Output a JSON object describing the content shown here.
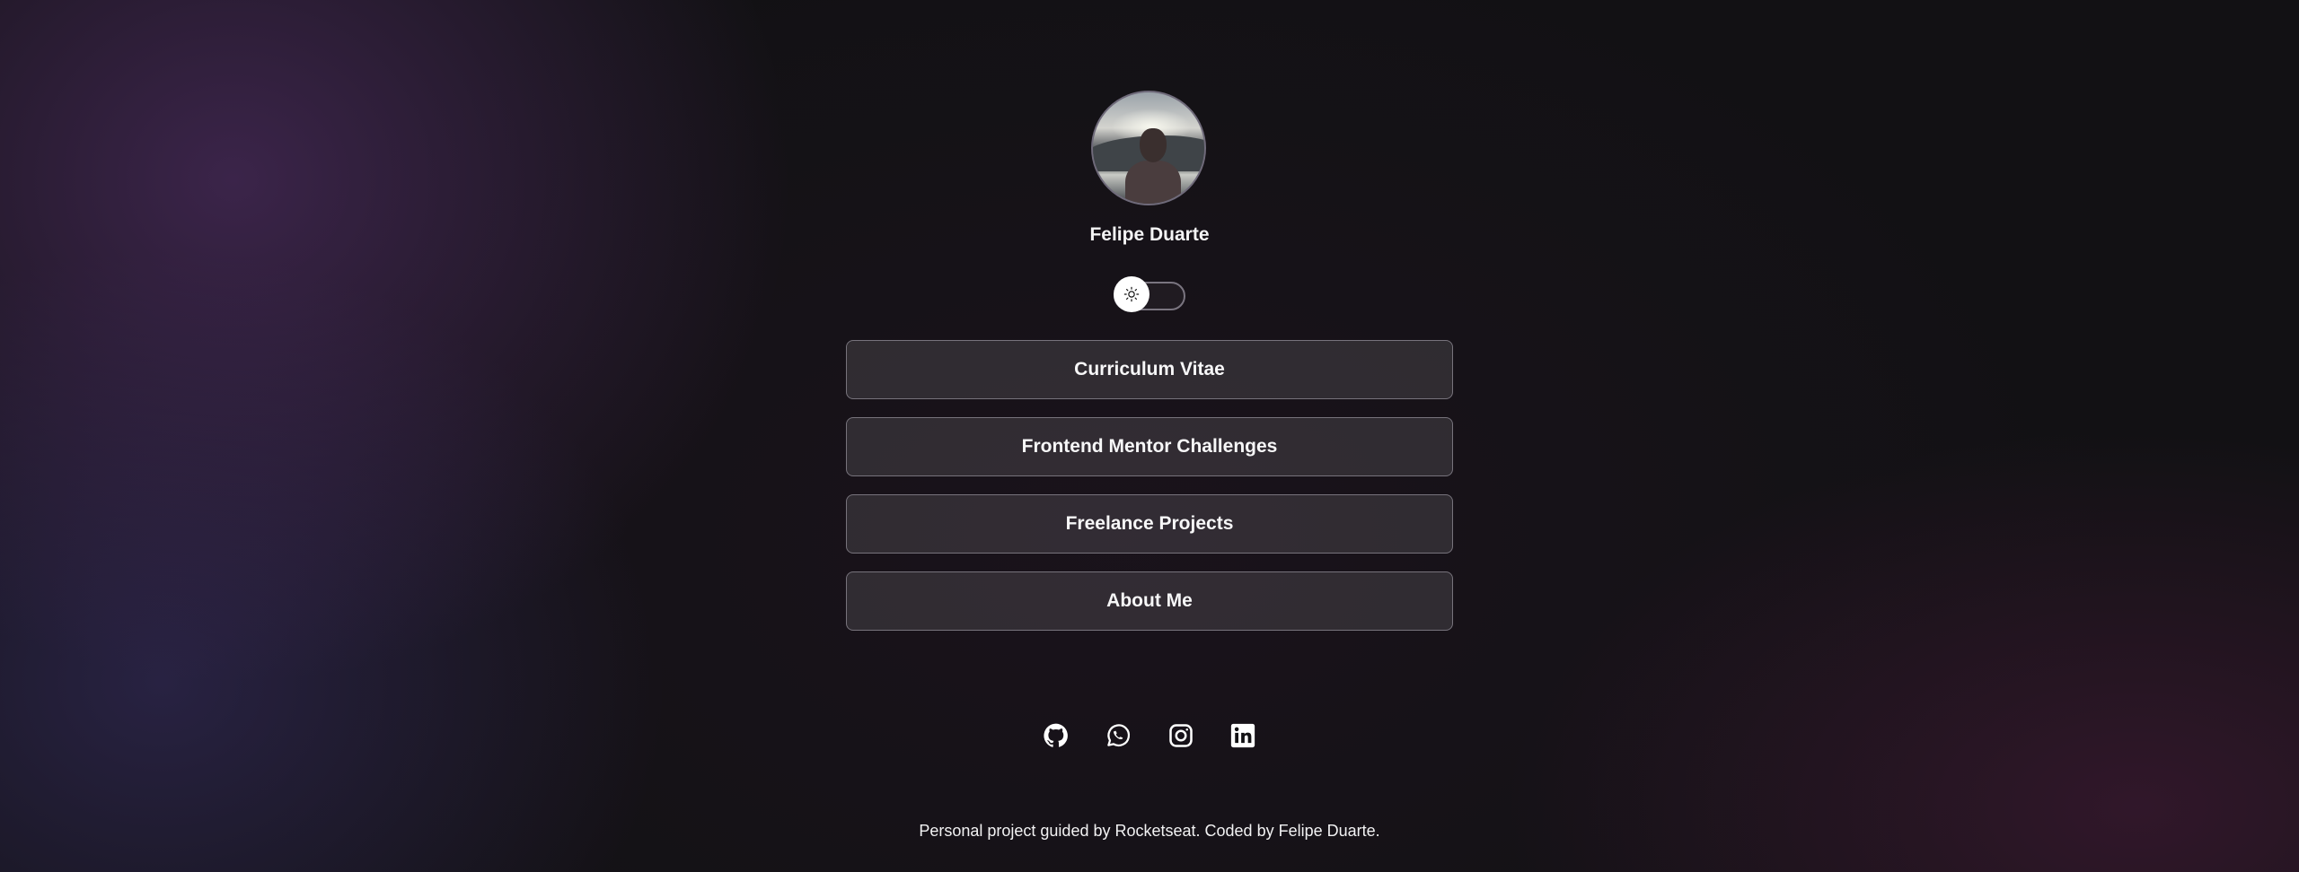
{
  "profile": {
    "name": "Felipe Duarte",
    "avatar_alt": "Felipe Duarte"
  },
  "theme_toggle": {
    "icon": "sun-icon",
    "state": "dark"
  },
  "links": [
    {
      "label": "Curriculum Vitae"
    },
    {
      "label": "Frontend Mentor Challenges"
    },
    {
      "label": "Freelance Projects"
    },
    {
      "label": "About Me"
    }
  ],
  "social": [
    {
      "icon": "github-icon"
    },
    {
      "icon": "whatsapp-icon"
    },
    {
      "icon": "instagram-icon"
    },
    {
      "icon": "linkedin-icon"
    }
  ],
  "footer": {
    "text": "Personal project guided by Rocketseat. Coded by Felipe Duarte."
  },
  "colors": {
    "background": "#121114",
    "accent_purple": "#5d3476",
    "button_bg": "#2a282d",
    "button_border": "#77737c",
    "text": "#f4f4f5"
  }
}
